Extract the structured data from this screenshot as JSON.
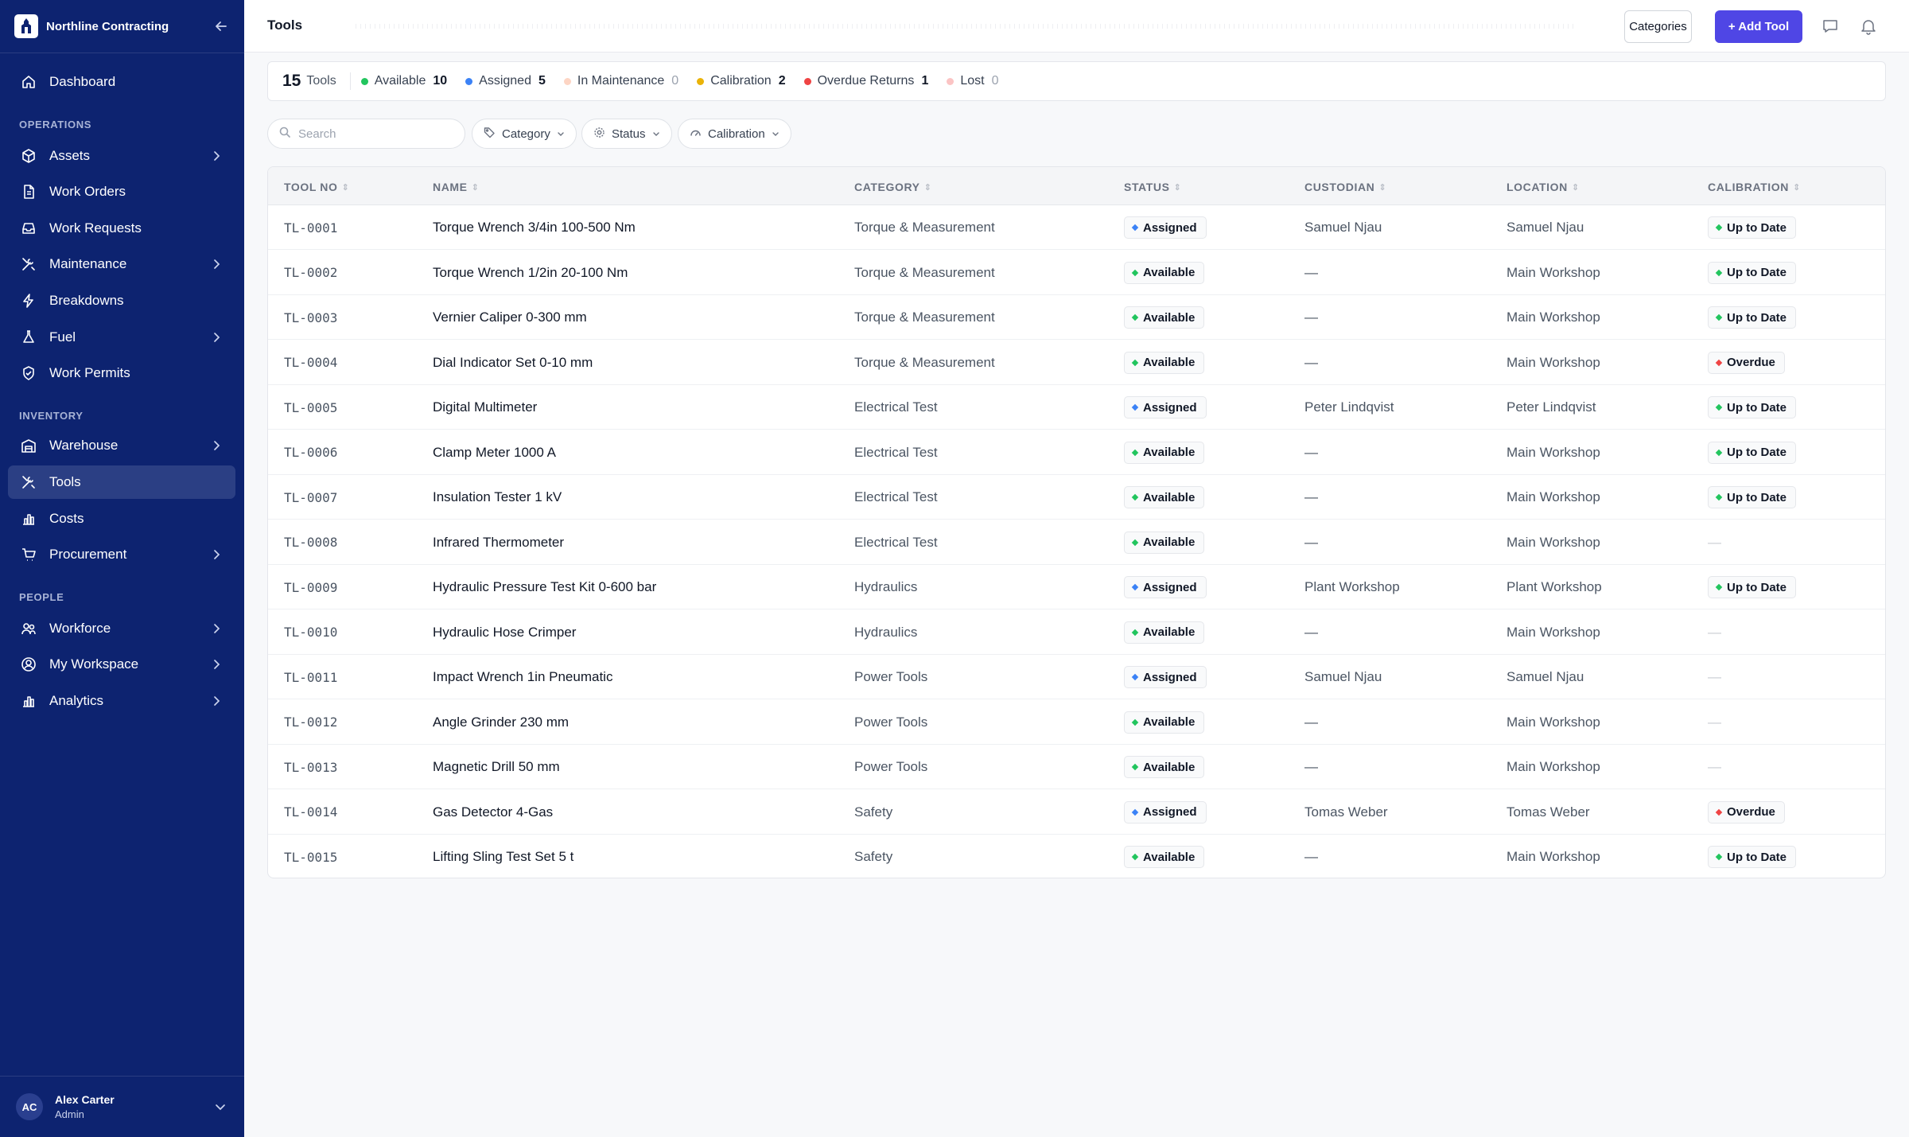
{
  "brand": {
    "name": "Northline Contracting"
  },
  "sidebar": {
    "sections": {
      "operations": "OPERATIONS",
      "inventory": "INVENTORY",
      "people": "PEOPLE"
    },
    "items": [
      {
        "label": "Dashboard",
        "icon": "home-icon"
      },
      {
        "label": "Assets",
        "icon": "cube-icon"
      },
      {
        "label": "Work Orders",
        "icon": "document-icon"
      },
      {
        "label": "Work Requests",
        "icon": "inbox-icon"
      },
      {
        "label": "Maintenance",
        "icon": "wrench-screwdriver-icon"
      },
      {
        "label": "Breakdowns",
        "icon": "bolt-icon"
      },
      {
        "label": "Fuel",
        "icon": "flask-icon"
      },
      {
        "label": "Work Permits",
        "icon": "shield-check-icon"
      },
      {
        "label": "Warehouse",
        "icon": "building-icon"
      },
      {
        "label": "Tools",
        "icon": "tools-icon"
      },
      {
        "label": "Costs",
        "icon": "bar-chart-icon"
      },
      {
        "label": "Procurement",
        "icon": "cart-icon"
      },
      {
        "label": "Workforce",
        "icon": "users-icon"
      },
      {
        "label": "My Workspace",
        "icon": "user-circle-icon"
      },
      {
        "label": "Analytics",
        "icon": "bar-chart-icon"
      }
    ],
    "user": {
      "initials": "AC",
      "name": "Alex Carter",
      "role": "Admin"
    }
  },
  "header": {
    "title": "Tools",
    "categories_label": "Categories",
    "add_label": "+ Add Tool"
  },
  "stats": {
    "total": "15",
    "total_label": "Tools",
    "items": [
      {
        "label": "Available",
        "count": "10",
        "color": "#22c55e"
      },
      {
        "label": "Assigned",
        "count": "5",
        "color": "#3b82f6"
      },
      {
        "label": "In Maintenance",
        "count": "0",
        "color": "#fdba9c"
      },
      {
        "label": "Calibration",
        "count": "2",
        "color": "#eab308"
      },
      {
        "label": "Overdue Returns",
        "count": "1",
        "color": "#ef4444"
      },
      {
        "label": "Lost",
        "count": "0",
        "color": "#fca5a5"
      }
    ]
  },
  "filters": {
    "search_placeholder": "Search",
    "category": "Category",
    "status": "Status",
    "calibration": "Calibration"
  },
  "table": {
    "columns": [
      "TOOL NO",
      "NAME",
      "CATEGORY",
      "STATUS",
      "CUSTODIAN",
      "LOCATION",
      "CALIBRATION"
    ],
    "rows": [
      {
        "no": "TL-0001",
        "name": "Torque Wrench 3/4in 100-500 Nm",
        "category": "Torque & Measurement",
        "status": "Assigned",
        "custodian": "Samuel Njau",
        "location": "Samuel Njau",
        "calibration": "Up to Date"
      },
      {
        "no": "TL-0002",
        "name": "Torque Wrench 1/2in 20-100 Nm",
        "category": "Torque & Measurement",
        "status": "Available",
        "custodian": "—",
        "location": "Main Workshop",
        "calibration": "Up to Date"
      },
      {
        "no": "TL-0003",
        "name": "Vernier Caliper 0-300 mm",
        "category": "Torque & Measurement",
        "status": "Available",
        "custodian": "—",
        "location": "Main Workshop",
        "calibration": "Up to Date"
      },
      {
        "no": "TL-0004",
        "name": "Dial Indicator Set 0-10 mm",
        "category": "Torque & Measurement",
        "status": "Available",
        "custodian": "—",
        "location": "Main Workshop",
        "calibration": "Overdue"
      },
      {
        "no": "TL-0005",
        "name": "Digital Multimeter",
        "category": "Electrical Test",
        "status": "Assigned",
        "custodian": "Peter Lindqvist",
        "location": "Peter Lindqvist",
        "calibration": "Up to Date"
      },
      {
        "no": "TL-0006",
        "name": "Clamp Meter 1000 A",
        "category": "Electrical Test",
        "status": "Available",
        "custodian": "—",
        "location": "Main Workshop",
        "calibration": "Up to Date"
      },
      {
        "no": "TL-0007",
        "name": "Insulation Tester 1 kV",
        "category": "Electrical Test",
        "status": "Available",
        "custodian": "—",
        "location": "Main Workshop",
        "calibration": "Up to Date"
      },
      {
        "no": "TL-0008",
        "name": "Infrared Thermometer",
        "category": "Electrical Test",
        "status": "Available",
        "custodian": "—",
        "location": "Main Workshop",
        "calibration": "—"
      },
      {
        "no": "TL-0009",
        "name": "Hydraulic Pressure Test Kit 0-600 bar",
        "category": "Hydraulics",
        "status": "Assigned",
        "custodian": "Plant Workshop",
        "location": "Plant Workshop",
        "calibration": "Up to Date"
      },
      {
        "no": "TL-0010",
        "name": "Hydraulic Hose Crimper",
        "category": "Hydraulics",
        "status": "Available",
        "custodian": "—",
        "location": "Main Workshop",
        "calibration": "—"
      },
      {
        "no": "TL-0011",
        "name": "Impact Wrench 1in Pneumatic",
        "category": "Power Tools",
        "status": "Assigned",
        "custodian": "Samuel Njau",
        "location": "Samuel Njau",
        "calibration": "—"
      },
      {
        "no": "TL-0012",
        "name": "Angle Grinder 230 mm",
        "category": "Power Tools",
        "status": "Available",
        "custodian": "—",
        "location": "Main Workshop",
        "calibration": "—"
      },
      {
        "no": "TL-0013",
        "name": "Magnetic Drill 50 mm",
        "category": "Power Tools",
        "status": "Available",
        "custodian": "—",
        "location": "Main Workshop",
        "calibration": "—"
      },
      {
        "no": "TL-0014",
        "name": "Gas Detector 4-Gas",
        "category": "Safety",
        "status": "Assigned",
        "custodian": "Tomas Weber",
        "location": "Tomas Weber",
        "calibration": "Overdue"
      },
      {
        "no": "TL-0015",
        "name": "Lifting Sling Test Set 5 t",
        "category": "Safety",
        "status": "Available",
        "custodian": "—",
        "location": "Main Workshop",
        "calibration": "Up to Date"
      }
    ]
  },
  "colors": {
    "sidebar_bg": "#0d2370",
    "accent": "#4f46e5",
    "available": "#22c55e",
    "assigned": "#3b82f6",
    "overdue": "#ef4444"
  }
}
